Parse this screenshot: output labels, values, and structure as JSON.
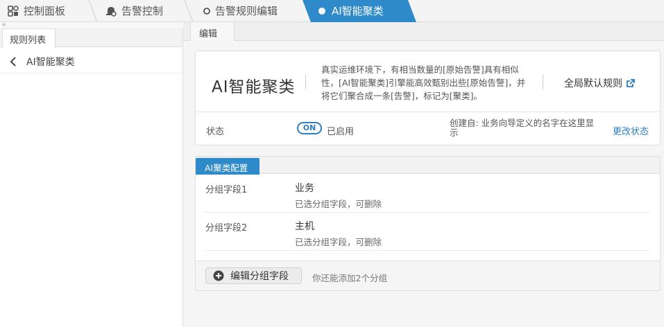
{
  "tabs": [
    {
      "label": "控制面板",
      "icon": "dashboard-icon"
    },
    {
      "label": "告警控制",
      "icon": "alarm-settings-icon"
    },
    {
      "label": "告警规则编辑",
      "icon": "circle-outline-icon"
    },
    {
      "label": "AI智能聚类",
      "icon": "circle-filled-icon",
      "active": true
    }
  ],
  "left_panel": {
    "collapse_glyph": "«",
    "tab_label": "规则列表",
    "items": [
      {
        "label": "AI智能聚类",
        "icon": "chevron-left-icon"
      }
    ]
  },
  "right_panel": {
    "tab_label": "编辑",
    "rule_card": {
      "title": "AI智能聚类",
      "description": "真实运维环境下，有相当数量的[原始告警]具有相似性，[AI智能聚类]引擎能高效甄别出些[原始告警]，并将它们聚合成一条[告警]，标记为[聚类]。",
      "global_rule_label": "全局默认规则",
      "status_label": "状态",
      "toggle_label": "ON",
      "status_value": "已启用",
      "created_by": "创建自: 业务向导定义的名字在这里显示",
      "change_status_label": "更改状态"
    },
    "config_card": {
      "tab_label": "AI聚类配置",
      "fields": [
        {
          "name": "分组字段1",
          "value": "业务",
          "hint": "已选分组字段，可删除"
        },
        {
          "name": "分组字段2",
          "value": "主机",
          "hint": "已选分组字段，可删除"
        }
      ],
      "edit_button_label": "编辑分组字段",
      "footer_hint": "你还能添加2个分组"
    }
  },
  "colors": {
    "accent": "#2f8ac9",
    "link": "#2b7cc4",
    "active_tab": "#2f8ac9"
  }
}
